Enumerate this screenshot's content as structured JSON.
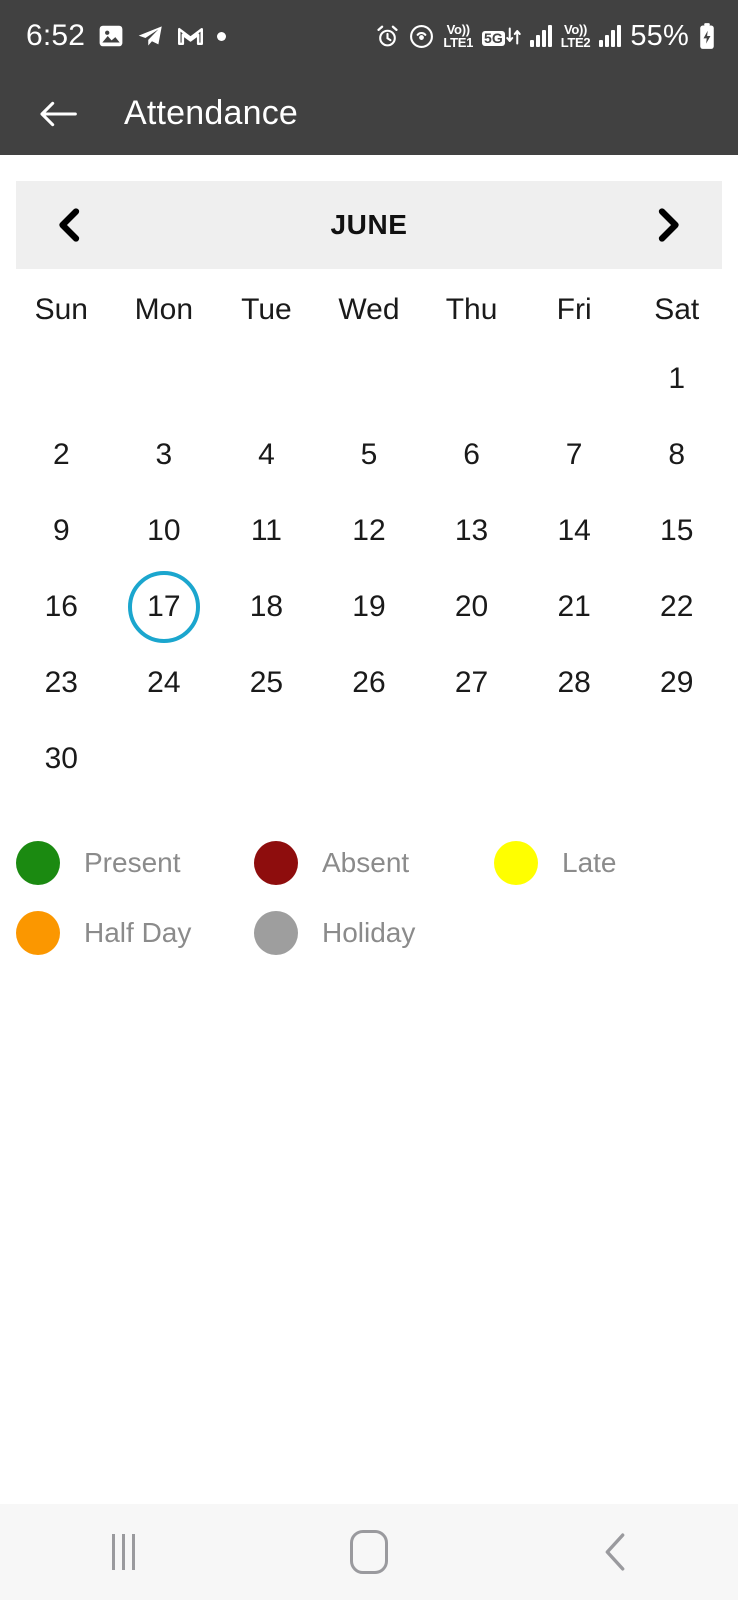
{
  "status_bar": {
    "time": "6:52",
    "battery_percent": "55%",
    "network_1": {
      "volte_line1": "Vo))",
      "volte_line2": "LTE1"
    },
    "network_2": {
      "volte_line1": "Vo))",
      "volte_line2": "LTE2"
    },
    "data_tag": "5G",
    "icons": [
      "photos-icon",
      "telegram-icon",
      "gmail-icon",
      "notification-dot-icon",
      "alarm-icon",
      "hotspot-icon",
      "battery-charging-icon"
    ]
  },
  "app_bar": {
    "back_label": "back-arrow",
    "title": "Attendance"
  },
  "calendar": {
    "month_label": "JUNE",
    "prev_label": "previous-month",
    "next_label": "next-month",
    "weekdays": [
      "Sun",
      "Mon",
      "Tue",
      "Wed",
      "Thu",
      "Fri",
      "Sat"
    ],
    "leading_blanks": 6,
    "days": [
      1,
      2,
      3,
      4,
      5,
      6,
      7,
      8,
      9,
      10,
      11,
      12,
      13,
      14,
      15,
      16,
      17,
      18,
      19,
      20,
      21,
      22,
      23,
      24,
      25,
      26,
      27,
      28,
      29,
      30
    ],
    "selected_day": 17,
    "selected_ring_color": "#1ba6ce"
  },
  "legend": {
    "rows": [
      [
        {
          "label": "Present",
          "color": "#1b8a11"
        },
        {
          "label": "Absent",
          "color": "#8e0d0d"
        },
        {
          "label": "Late",
          "color": "#ffff00"
        }
      ],
      [
        {
          "label": "Half Day",
          "color": "#fb9700"
        },
        {
          "label": "Holiday",
          "color": "#9e9e9e"
        }
      ]
    ]
  },
  "nav_bar": {
    "recents_label": "recents",
    "home_label": "home",
    "back_label": "back"
  },
  "colors": {
    "header_bg": "#414141",
    "month_bar_bg": "#efefef",
    "nav_bar_bg": "#f7f7f7",
    "text_dark": "#1a1a1a",
    "legend_text": "#8b8b8b"
  }
}
